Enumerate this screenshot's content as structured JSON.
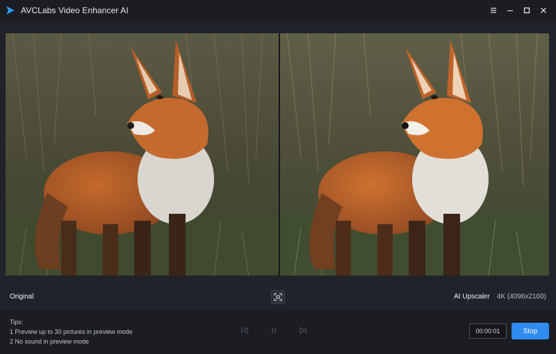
{
  "app": {
    "title": "AVCLabs Video Enhancer AI",
    "accent_color": "#2f8cf0",
    "logo_icon": "play-triangle-logo-icon"
  },
  "window_controls": {
    "icons": [
      "hamburger-menu-icon",
      "minimize-icon",
      "maximize-icon",
      "close-icon"
    ]
  },
  "preview": {
    "left_label": "Original",
    "right_model": "AI Upscaler",
    "right_resolution": "4K (4096x2160)",
    "fit_icon": "fit-screen-icon"
  },
  "tips": {
    "heading": "Tips:",
    "line1": "1 Preview up to 30 pictures in preview mode",
    "line2": "2 No sound in preview mode"
  },
  "playback": {
    "icons": [
      "skip-previous-icon",
      "pause-icon",
      "skip-next-icon"
    ],
    "timer": "00:00:01",
    "stop_label": "Stop"
  }
}
